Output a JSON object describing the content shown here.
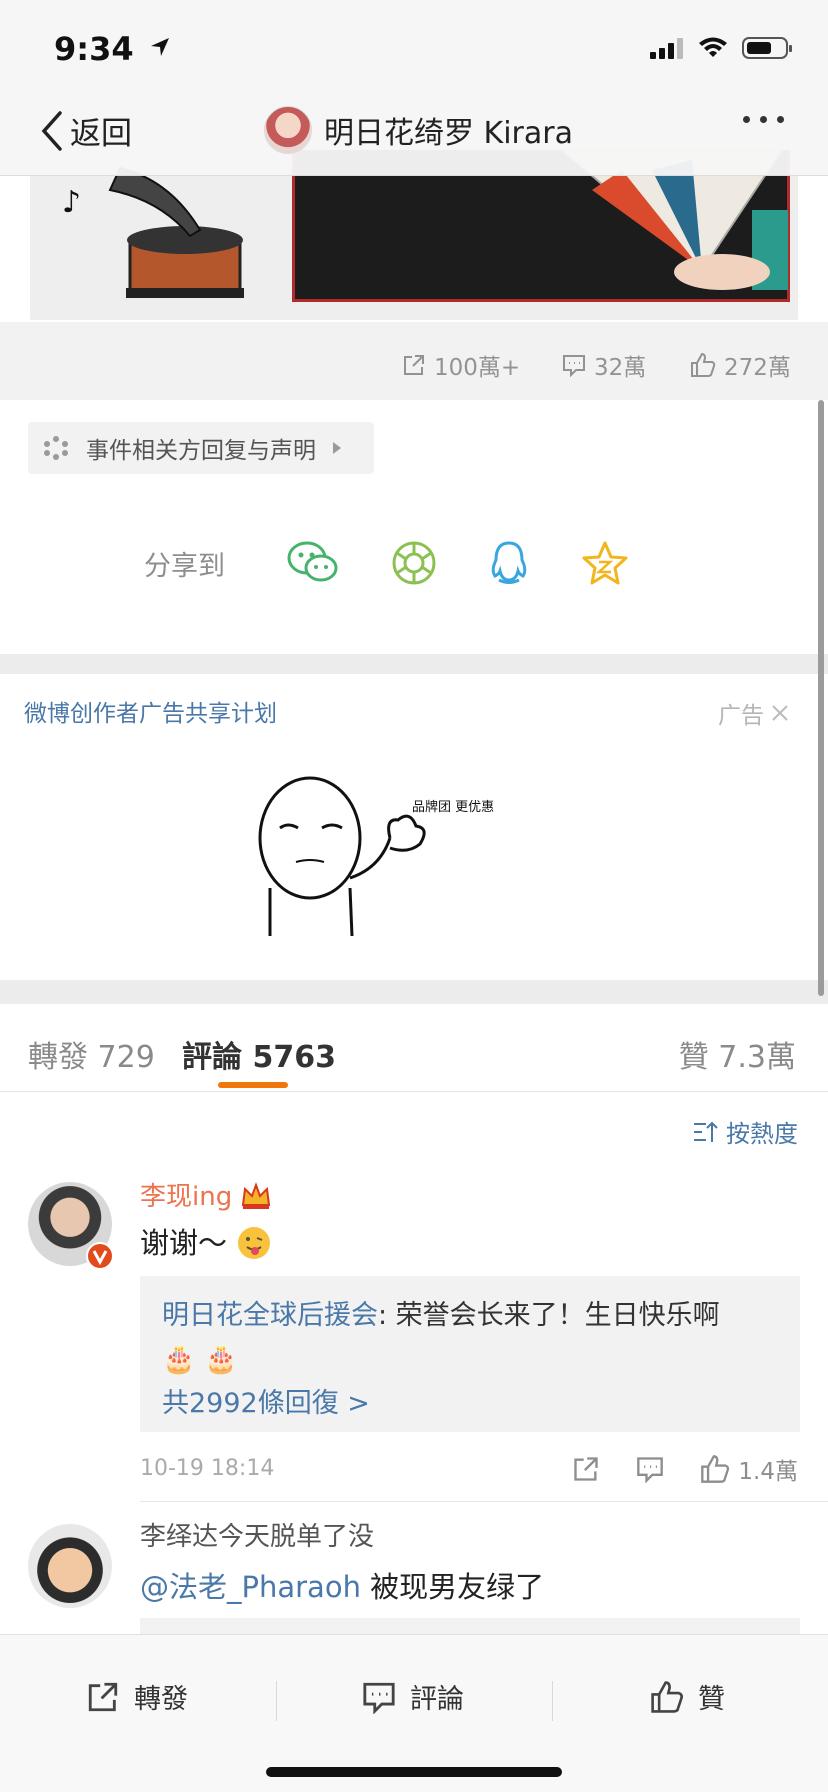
{
  "status": {
    "time": "9:34"
  },
  "nav": {
    "back_label": "返回",
    "title": "明日花绮罗 Kirara"
  },
  "counts": {
    "repost": "100萬+",
    "comments": "32萬",
    "likes": "272萬"
  },
  "event_tag": {
    "label": "事件相关方回复与声明"
  },
  "share": {
    "label": "分享到",
    "targets": [
      "wechat-icon",
      "moments-icon",
      "qq-icon",
      "qzone-icon"
    ],
    "colors": {
      "wechat": "#45b36b",
      "moments": "#8cc152",
      "qq": "#3aa6e0",
      "qzone": "#f2b51b"
    }
  },
  "ad": {
    "title": "微博创作者广告共享计划",
    "label": "广告",
    "bubble_text": "品牌团 更优惠"
  },
  "tabs": {
    "repost": "轉發 729",
    "comment": "評論 5763",
    "like": "贊 7.3萬"
  },
  "sort": {
    "label": "按熱度"
  },
  "comments": [
    {
      "name": "李现ing",
      "text": "谢谢～",
      "reply_author": "明日花全球后援会",
      "reply_text": ": 荣誉会长来了！生日快乐啊",
      "reply_more": "共2992條回復 >",
      "time": "10-19 18:14",
      "likes": "1.4萬"
    },
    {
      "name": "李绎达今天脱单了没",
      "mention": "@法老_Pharaoh",
      "text": " 被现男友绿了"
    }
  ],
  "bottom_bar": {
    "repost": "轉發",
    "comment": "評論",
    "like": "贊"
  },
  "colors": {
    "accent": "#f1770d",
    "link": "#4a78a8",
    "name_orange": "#eb7350"
  }
}
